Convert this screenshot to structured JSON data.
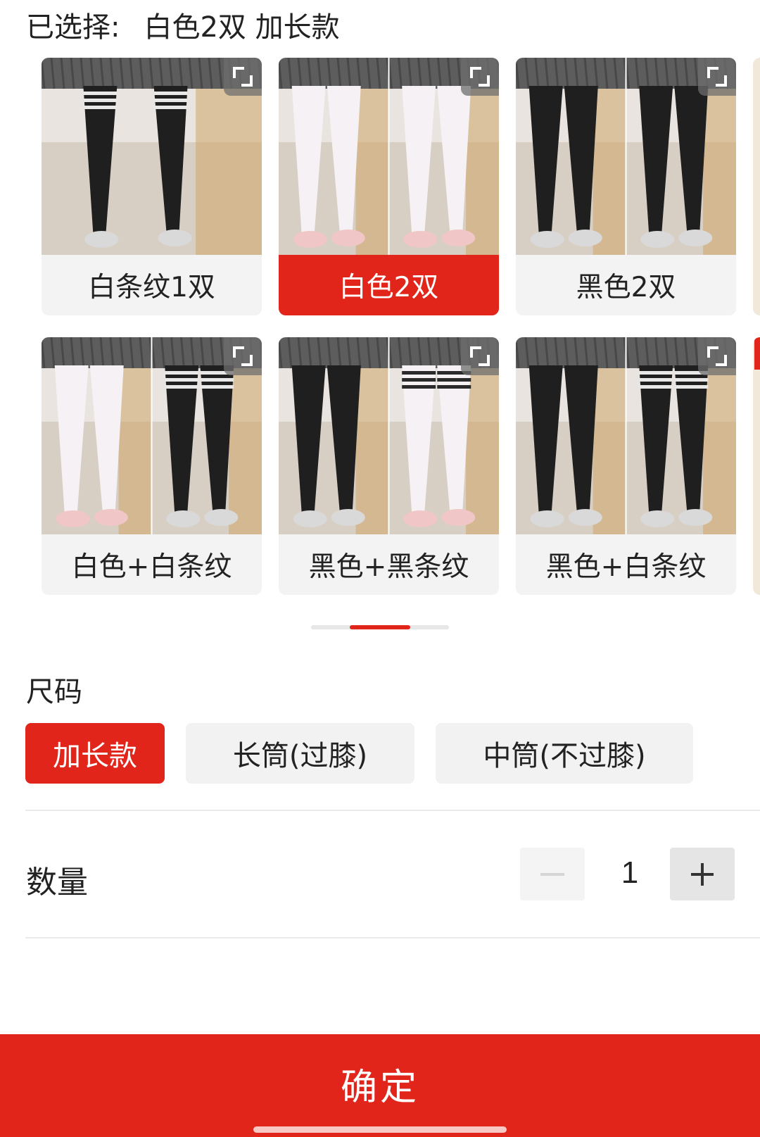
{
  "selection": {
    "label": "已选择:",
    "value": "白色2双 加长款"
  },
  "variants": [
    {
      "label": "白条纹1双",
      "selected": false,
      "legs": [
        "black-striped"
      ]
    },
    {
      "label": "白色2双",
      "selected": true,
      "legs": [
        "white",
        "white"
      ]
    },
    {
      "label": "黑色2双",
      "selected": false,
      "legs": [
        "black",
        "black"
      ]
    },
    {
      "label": "白色+白条纹",
      "selected": false,
      "legs": [
        "white",
        "black-striped"
      ]
    },
    {
      "label": "黑色+黑条纹",
      "selected": false,
      "legs": [
        "black",
        "white-striped"
      ]
    },
    {
      "label": "黑色+白条纹",
      "selected": false,
      "legs": [
        "black",
        "black-striped"
      ]
    }
  ],
  "scroll_position": 0.5,
  "size": {
    "title": "尺码",
    "options": [
      {
        "label": "加长款",
        "selected": true
      },
      {
        "label": "长筒(过膝)",
        "selected": false
      },
      {
        "label": "中筒(不过膝)",
        "selected": false
      }
    ]
  },
  "quantity": {
    "label": "数量",
    "value": "1",
    "minus_icon": "minus-icon",
    "plus_icon": "plus-icon"
  },
  "confirm": {
    "label": "确定"
  },
  "colors": {
    "accent": "#e1251b",
    "chip_bg": "#f2f2f2",
    "text": "#222222"
  }
}
